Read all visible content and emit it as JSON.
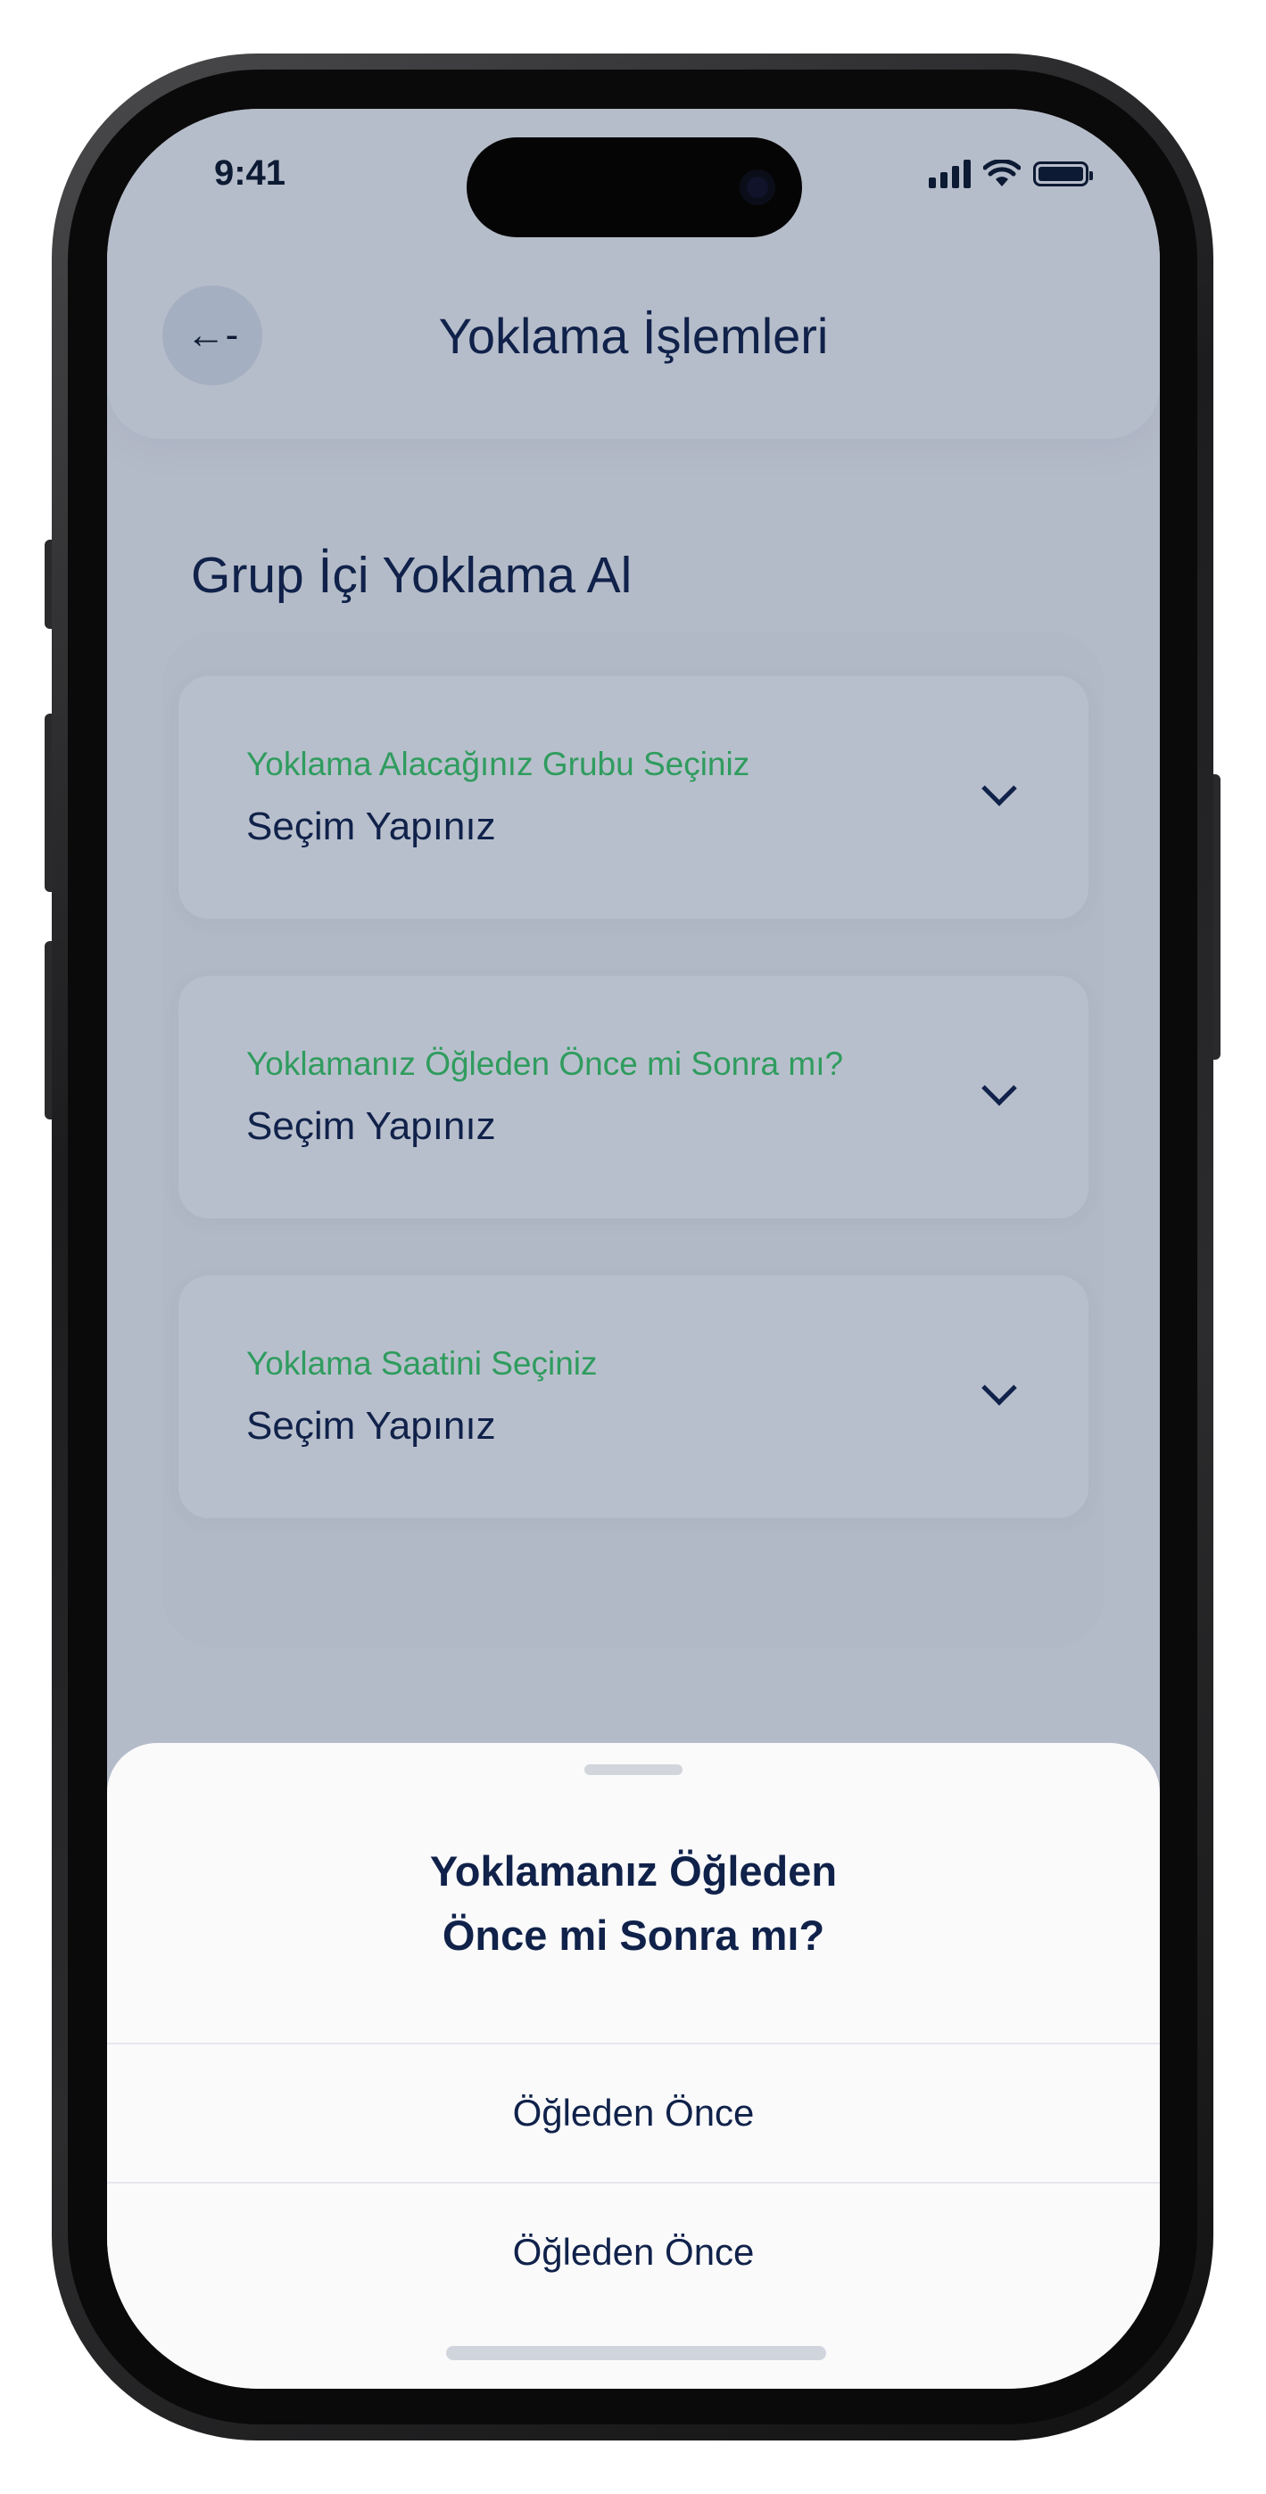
{
  "status_bar": {
    "time": "9:41"
  },
  "header": {
    "title": "Yoklama İşlemleri",
    "back_icon": "←-"
  },
  "main": {
    "section_title": "Grup İçi Yoklama Al",
    "fields": [
      {
        "label": "Yoklama Alacağınız Grubu Seçiniz",
        "value": "Seçim Yapınız"
      },
      {
        "label": "Yoklamanız Öğleden Önce mi Sonra mı?",
        "value": "Seçim Yapınız"
      },
      {
        "label": "Yoklama Saatini Seçiniz",
        "value": "Seçim Yapınız"
      }
    ]
  },
  "sheet": {
    "title_line1": "Yoklamanız Öğleden",
    "title_line2": "Önce mi Sonra mı?",
    "options": [
      {
        "label": "Öğleden Önce"
      },
      {
        "label": "Öğleden Önce"
      }
    ]
  },
  "colors": {
    "accent_label": "#2f9c5e",
    "text_primary": "#10224a",
    "overlay_bg": "#b4bbc8",
    "sheet_bg": "#fafafb"
  }
}
